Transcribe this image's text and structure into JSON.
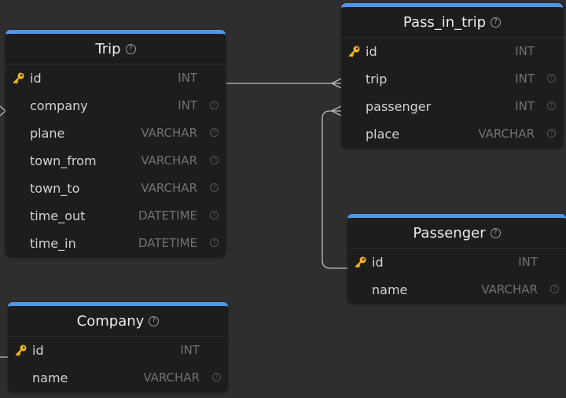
{
  "colors": {
    "background": "#2e2e2e",
    "table_body": "#1d1d1d",
    "table_accent": "#4f97e6",
    "primary_key_icon": "#f0b323",
    "connector": "#bdbdbd",
    "type_text": "#727272"
  },
  "tables": {
    "trip": {
      "name": "Trip",
      "columns": [
        {
          "name": "id",
          "type": "INT",
          "primary_key": true
        },
        {
          "name": "company",
          "type": "INT"
        },
        {
          "name": "plane",
          "type": "VARCHAR"
        },
        {
          "name": "town_from",
          "type": "VARCHAR"
        },
        {
          "name": "town_to",
          "type": "VARCHAR"
        },
        {
          "name": "time_out",
          "type": "DATETIME"
        },
        {
          "name": "time_in",
          "type": "DATETIME"
        }
      ]
    },
    "pass_in_trip": {
      "name": "Pass_in_trip",
      "columns": [
        {
          "name": "id",
          "type": "INT",
          "primary_key": true
        },
        {
          "name": "trip",
          "type": "INT"
        },
        {
          "name": "passenger",
          "type": "INT"
        },
        {
          "name": "place",
          "type": "VARCHAR"
        }
      ]
    },
    "passenger": {
      "name": "Passenger",
      "columns": [
        {
          "name": "id",
          "type": "INT",
          "primary_key": true
        },
        {
          "name": "name",
          "type": "VARCHAR"
        }
      ]
    },
    "company": {
      "name": "Company",
      "columns": [
        {
          "name": "id",
          "type": "INT",
          "primary_key": true
        },
        {
          "name": "name",
          "type": "VARCHAR"
        }
      ]
    }
  },
  "relations": [
    {
      "from": "Trip.id",
      "to": "Pass_in_trip.trip"
    },
    {
      "from": "Passenger.id",
      "to": "Pass_in_trip.passenger"
    },
    {
      "from": "Company.id",
      "to": "Trip.company"
    }
  ]
}
